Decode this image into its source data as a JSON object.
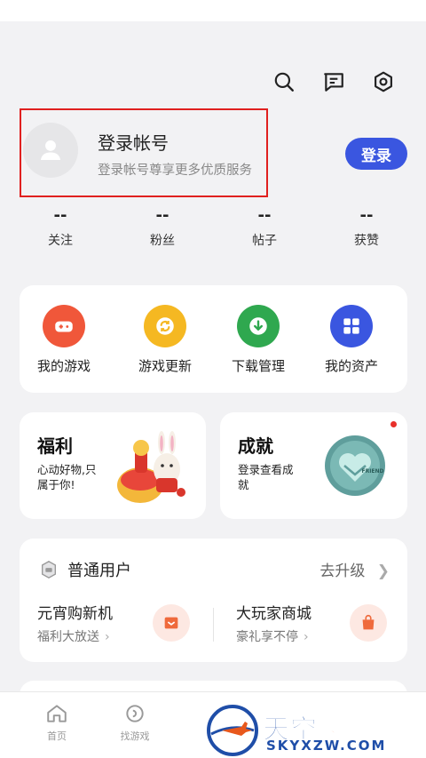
{
  "header": {
    "icons": [
      "search-icon",
      "message-icon",
      "settings-icon"
    ]
  },
  "profile": {
    "title": "登录帐号",
    "subtitle": "登录帐号尊享更多优质服务",
    "login_button": "登录"
  },
  "stats": [
    {
      "value": "--",
      "label": "关注"
    },
    {
      "value": "--",
      "label": "粉丝"
    },
    {
      "value": "--",
      "label": "帖子"
    },
    {
      "value": "--",
      "label": "获赞"
    }
  ],
  "quick_actions": [
    {
      "label": "我的游戏",
      "icon": "gamepad-icon",
      "color": "#f0573a"
    },
    {
      "label": "游戏更新",
      "icon": "refresh-icon",
      "color": "#f5b822"
    },
    {
      "label": "下载管理",
      "icon": "download-icon",
      "color": "#2fa84f"
    },
    {
      "label": "我的资产",
      "icon": "grid-icon",
      "color": "#3a56e0"
    }
  ],
  "welfare": {
    "title": "福利",
    "subtitle": "心动好物,只属于你!"
  },
  "achievement": {
    "title": "成就",
    "subtitle": "登录查看成就",
    "badge_text": "FRIEND"
  },
  "member": {
    "title": "普通用户",
    "upgrade": "去升级",
    "tiles": [
      {
        "title": "元宵购新机",
        "subtitle": "福利大放送"
      },
      {
        "title": "大玩家商城",
        "subtitle": "豪礼享不停"
      }
    ]
  },
  "bottom_nav": [
    {
      "label": "首页",
      "icon": "home-icon"
    },
    {
      "label": "找游戏",
      "icon": "find-game-icon"
    }
  ],
  "watermark": {
    "line1": "天空",
    "line1b": "下载玩",
    "line2": "SKYXZW.COM"
  }
}
